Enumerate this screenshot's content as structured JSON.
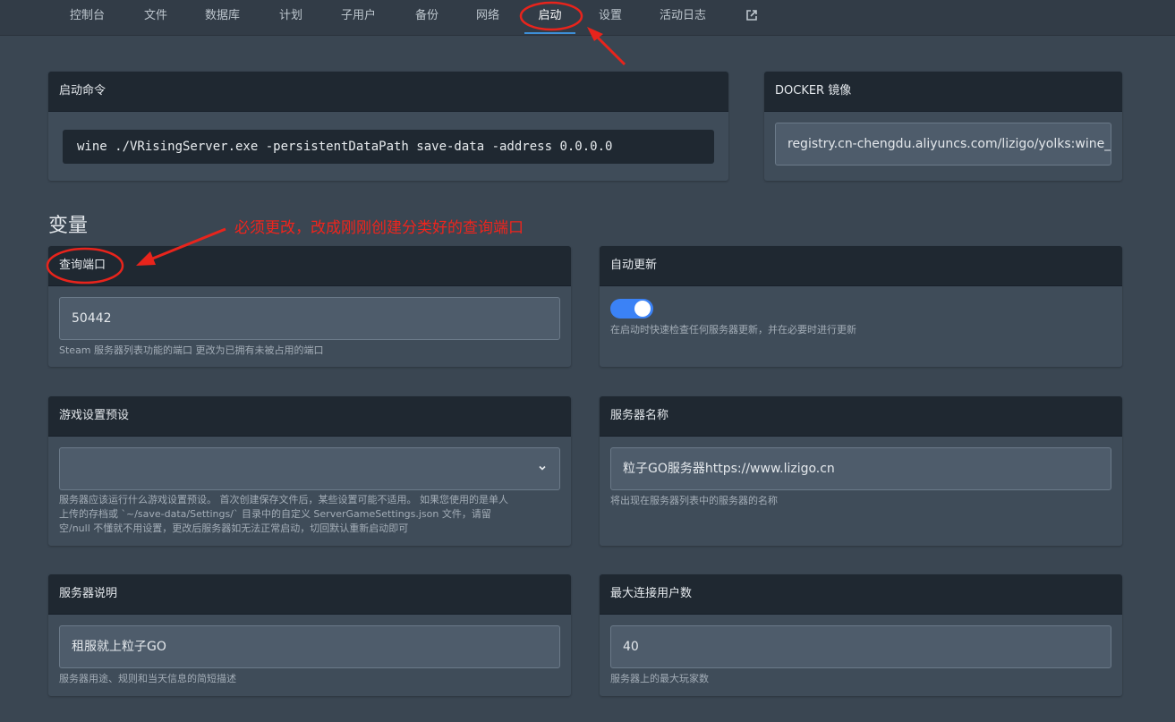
{
  "nav": {
    "items": [
      "控制台",
      "文件",
      "数据库",
      "计划",
      "子用户",
      "备份",
      "网络",
      "启动",
      "设置",
      "活动日志"
    ],
    "active": "启动",
    "external_icon": "external-link-icon"
  },
  "startup": {
    "title": "启动命令",
    "command": "wine ./VRisingServer.exe -persistentDataPath save-data -address 0.0.0.0"
  },
  "docker": {
    "title": "DOCKER 镜像",
    "image": "registry.cn-chengdu.aliyuncs.com/lizigo/yolks:wine_s"
  },
  "variables": {
    "title": "变量",
    "query_port": {
      "label": "查询端口",
      "value": "50442",
      "help": "Steam 服务器列表功能的端口 更改为已拥有未被占用的端口"
    },
    "auto_update": {
      "label": "自动更新",
      "enabled": true,
      "help": "在启动时快速检查任何服务器更新，并在必要时进行更新"
    },
    "preset": {
      "label": "游戏设置预设",
      "value": "",
      "help_lines": [
        "服务器应该运行什么游戏设置预设。 首次创建保存文件后，某些设置可能不适用。 如果您使用的是单人",
        "上传的存档或 `~/save-data/Settings/` 目录中的自定义 ServerGameSettings.json 文件，请留",
        "空/null 不懂就不用设置，更改后服务器如无法正常启动，切回默认重新启动即可"
      ]
    },
    "server_name": {
      "label": "服务器名称",
      "value": "粒子GO服务器https://www.lizigo.cn",
      "help": "将出现在服务器列表中的服务器的名称"
    },
    "description": {
      "label": "服务器说明",
      "value": "租服就上粒子GO",
      "help": "服务器用途、规则和当天信息的简短描述"
    },
    "max_users": {
      "label": "最大连接用户数",
      "value": "40",
      "help": "服务器上的最大玩家数"
    }
  },
  "annotation": {
    "text": "必须更改，改成刚刚创建分类好的查询端口",
    "color": "#f0241c"
  }
}
